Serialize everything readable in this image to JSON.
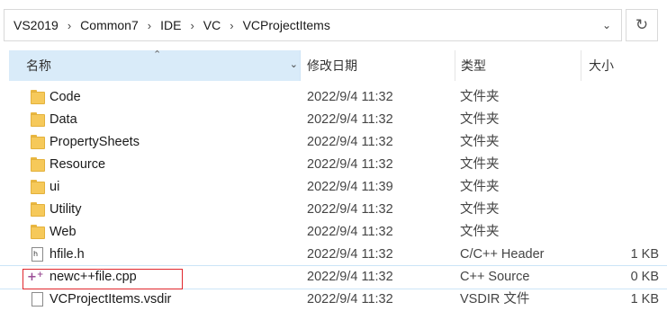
{
  "breadcrumbs": [
    "VS2019",
    "Common7",
    "IDE",
    "VC",
    "VCProjectItems"
  ],
  "breadcrumb_separator": "›",
  "columns": {
    "name": "名称",
    "date": "修改日期",
    "type": "类型",
    "size": "大小"
  },
  "files": [
    {
      "name": "Code",
      "date": "2022/9/4 11:32",
      "type": "文件夹",
      "size": "",
      "icon": "folder-icon"
    },
    {
      "name": "Data",
      "date": "2022/9/4 11:32",
      "type": "文件夹",
      "size": "",
      "icon": "folder-icon"
    },
    {
      "name": "PropertySheets",
      "date": "2022/9/4 11:32",
      "type": "文件夹",
      "size": "",
      "icon": "folder-icon"
    },
    {
      "name": "Resource",
      "date": "2022/9/4 11:32",
      "type": "文件夹",
      "size": "",
      "icon": "folder-icon"
    },
    {
      "name": "ui",
      "date": "2022/9/4 11:39",
      "type": "文件夹",
      "size": "",
      "icon": "folder-icon"
    },
    {
      "name": "Utility",
      "date": "2022/9/4 11:32",
      "type": "文件夹",
      "size": "",
      "icon": "folder-icon"
    },
    {
      "name": "Web",
      "date": "2022/9/4 11:32",
      "type": "文件夹",
      "size": "",
      "icon": "folder-icon"
    },
    {
      "name": "hfile.h",
      "date": "2022/9/4 11:32",
      "type": "C/C++ Header",
      "size": "1 KB",
      "icon": "header-file-icon"
    },
    {
      "name": "newc++file.cpp",
      "date": "2022/9/4 11:32",
      "type": "C++ Source",
      "size": "0 KB",
      "icon": "cpp-file-icon",
      "highlighted": true
    },
    {
      "name": "VCProjectItems.vsdir",
      "date": "2022/9/4 11:32",
      "type": "VSDIR 文件",
      "size": "1 KB",
      "icon": "file-icon"
    }
  ],
  "colors": {
    "header_selected_bg": "#d9ebf9",
    "folder_yellow": "#f6c95a",
    "annotation_red": "#e0262c"
  }
}
